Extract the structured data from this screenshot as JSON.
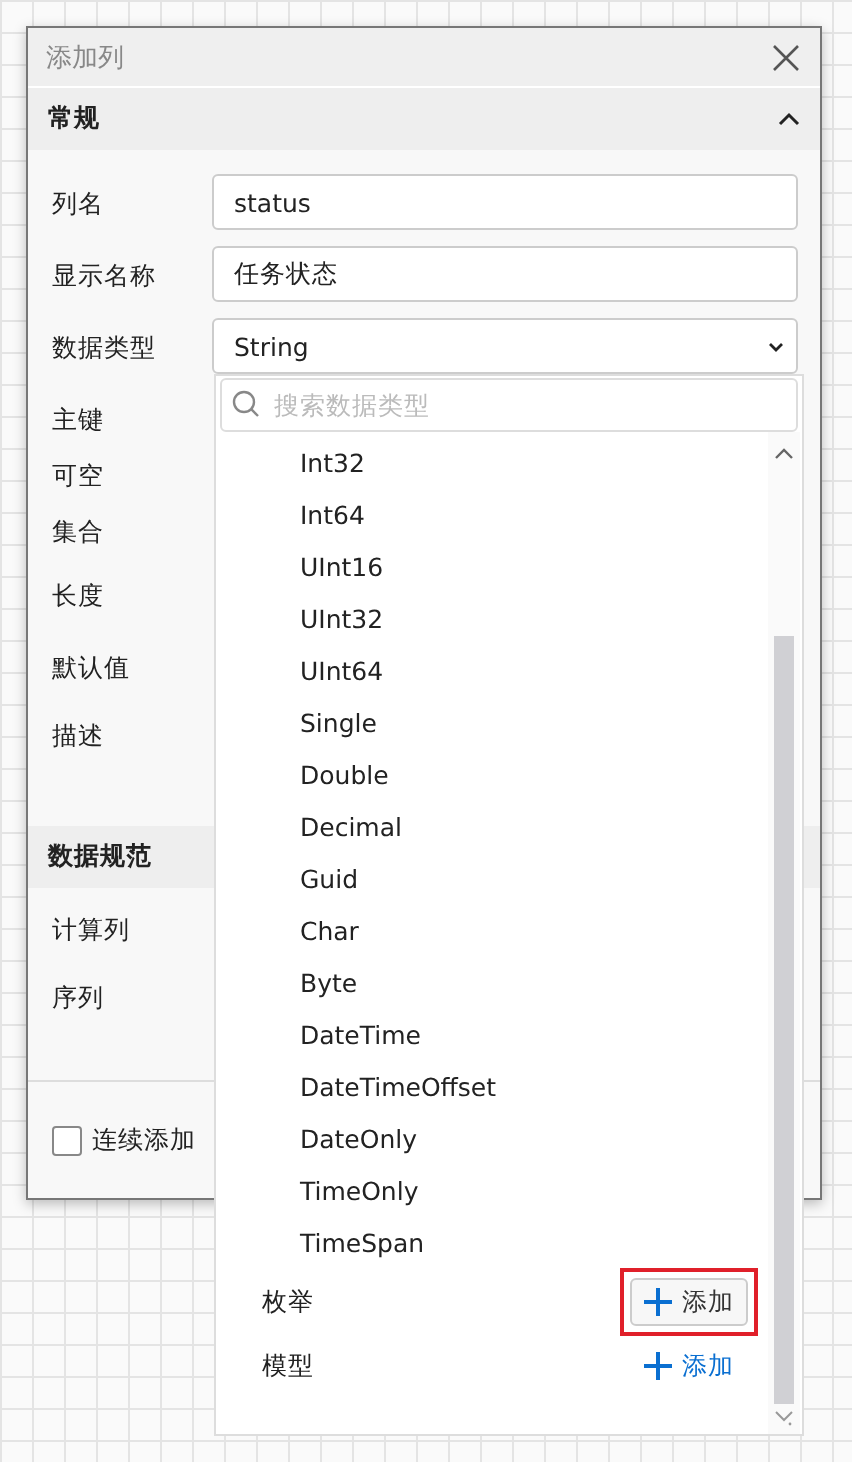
{
  "dialog": {
    "title": "添加列",
    "sections": [
      {
        "title": "常规",
        "expanded": true,
        "fields": [
          {
            "label": "列名",
            "kind": "text",
            "value": "status"
          },
          {
            "label": "显示名称",
            "kind": "text",
            "value": "任务状态"
          },
          {
            "label": "数据类型",
            "kind": "select",
            "value": "String"
          },
          {
            "label": "主键",
            "kind": "plain"
          },
          {
            "label": "可空",
            "kind": "plain"
          },
          {
            "label": "集合",
            "kind": "plain"
          },
          {
            "label": "长度",
            "kind": "plain"
          },
          {
            "label": "默认值",
            "kind": "plain"
          },
          {
            "label": "描述",
            "kind": "plain"
          }
        ]
      },
      {
        "title": "数据规范",
        "fields": [
          {
            "label": "计算列",
            "kind": "plain"
          },
          {
            "label": "序列",
            "kind": "plain"
          }
        ]
      }
    ],
    "footer": {
      "checkbox": {
        "label": "连续添加",
        "checked": false
      }
    }
  },
  "dropdown": {
    "search": {
      "placeholder": "搜索数据类型"
    },
    "items": [
      "Int32",
      "Int64",
      "UInt16",
      "UInt32",
      "UInt64",
      "Single",
      "Double",
      "Decimal",
      "Guid",
      "Char",
      "Byte",
      "DateTime",
      "DateTimeOffset",
      "DateOnly",
      "TimeOnly",
      "TimeSpan"
    ],
    "groups": [
      {
        "label": "枚举",
        "button": {
          "kind": "outlined",
          "label": "添加",
          "highlighted": true
        }
      },
      {
        "label": "模型",
        "button": {
          "kind": "link",
          "label": "添加",
          "highlighted": false
        }
      }
    ]
  }
}
